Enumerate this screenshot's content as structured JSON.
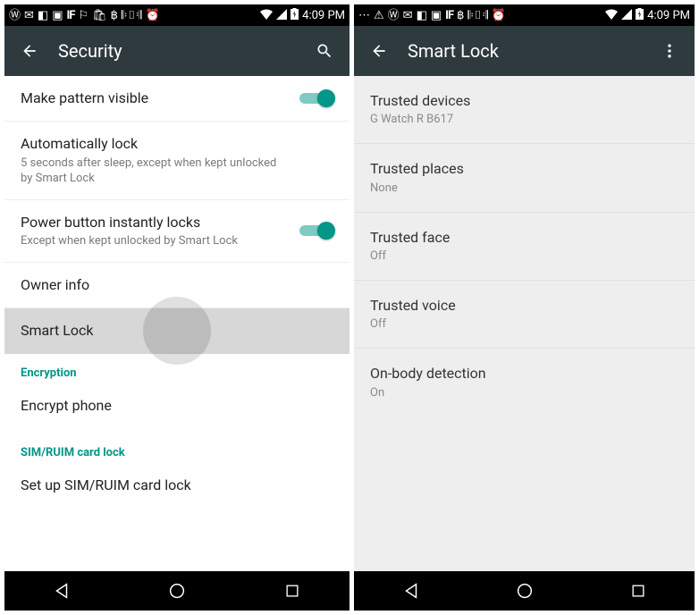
{
  "status": {
    "time": "4:09 PM",
    "battery_charging": true
  },
  "left": {
    "header": {
      "title": "Security"
    },
    "items": {
      "make_pattern": {
        "title": "Make pattern visible",
        "toggle": true
      },
      "auto_lock": {
        "title": "Automatically lock",
        "sub": "5 seconds after sleep, except when kept unlocked by Smart Lock"
      },
      "power_button": {
        "title": "Power button instantly locks",
        "sub": "Except when kept unlocked by Smart Lock",
        "toggle": true
      },
      "owner_info": {
        "title": "Owner info"
      },
      "smart_lock": {
        "title": "Smart Lock"
      }
    },
    "sections": {
      "encryption": {
        "header": "Encryption",
        "item": "Encrypt phone"
      },
      "sim": {
        "header": "SIM/RUIM card lock",
        "item": "Set up SIM/RUIM card lock"
      }
    }
  },
  "right": {
    "header": {
      "title": "Smart Lock"
    },
    "items": {
      "trusted_devices": {
        "title": "Trusted devices",
        "sub": "G Watch R B617"
      },
      "trusted_places": {
        "title": "Trusted places",
        "sub": "None"
      },
      "trusted_face": {
        "title": "Trusted face",
        "sub": "Off"
      },
      "trusted_voice": {
        "title": "Trusted voice",
        "sub": "Off"
      },
      "onbody": {
        "title": "On-body detection",
        "sub": "On"
      }
    }
  }
}
